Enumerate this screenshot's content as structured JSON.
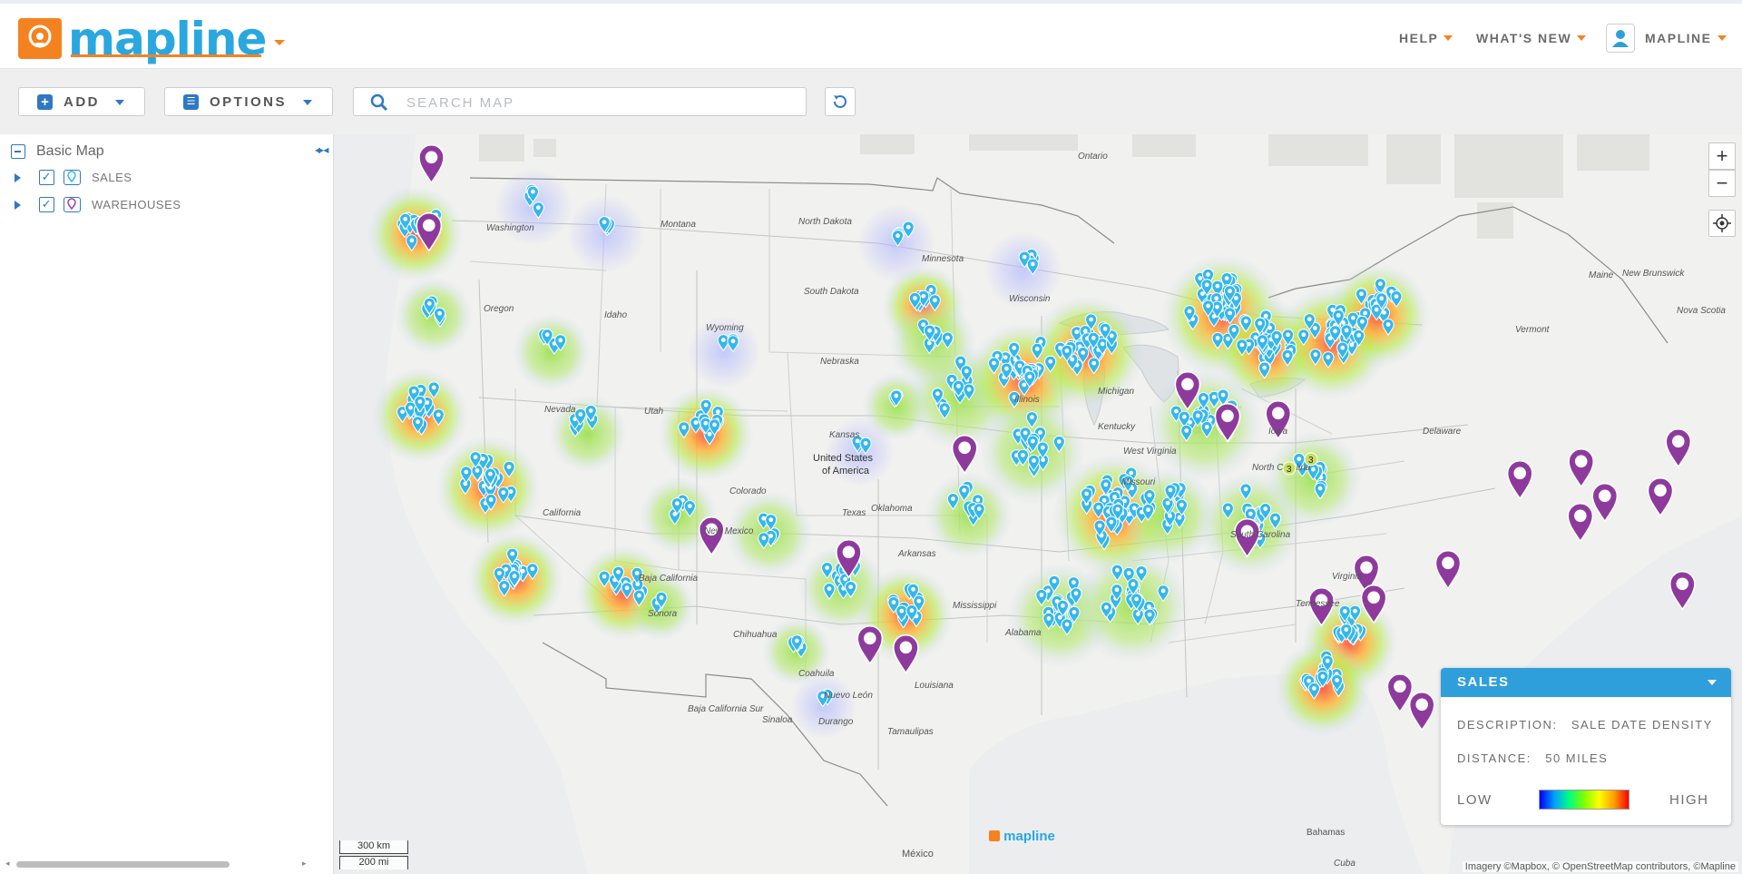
{
  "header": {
    "logo_text": "mapline",
    "nav": {
      "help": "HELP",
      "whats_new": "WHAT'S NEW",
      "account": "MAPLINE"
    }
  },
  "toolbar": {
    "add_label": "ADD",
    "options_label": "OPTIONS",
    "search_placeholder": "SEARCH MAP"
  },
  "sidebar": {
    "root_label": "Basic Map",
    "layers": [
      {
        "label": "SALES",
        "checked": true
      },
      {
        "label": "WAREHOUSES",
        "checked": true
      }
    ]
  },
  "map": {
    "labels": {
      "ontario": "Ontario",
      "montana": "Montana",
      "north_dakota": "North Dakota",
      "washington": "Washington",
      "minnesota": "Minnesota",
      "south_dakota": "South Dakota",
      "idaho": "Idaho",
      "oregon": "Oregon",
      "wyoming": "Wyoming",
      "wisconsin": "Wisconsin",
      "michigan": "Michigan",
      "nebraska": "Nebraska",
      "iowa": "Iowa",
      "united_states_1": "United States",
      "united_states_2": "of America",
      "nevada": "Nevada",
      "utah": "Utah",
      "colorado": "Colorado",
      "illinois": "Illinois",
      "kansas": "Kansas",
      "missouri": "Missouri",
      "kentucky": "Kentucky",
      "west_virginia": "West Virginia",
      "california": "California",
      "new_mexico": "New Mexico",
      "oklahoma": "Oklahoma",
      "arkansas": "Arkansas",
      "tennessee": "Tennessee",
      "north_carolina": "North Carolina",
      "south_carolina": "South Carolina",
      "virginia": "Virginia",
      "mississippi": "Mississippi",
      "alabama": "Alabama",
      "louisiana": "Louisiana",
      "texas": "Texas",
      "baja": "Baja California",
      "sonora": "Sonora",
      "chihuahua": "Chihuahua",
      "coahuila": "Coahuila",
      "nuevo_leon": "Nuevo León",
      "baja_sur": "Baja California Sur",
      "sinaloa": "Sinaloa",
      "durango": "Durango",
      "tamaulipas": "Tamaulipas",
      "mexico": "México",
      "cuba": "Cuba",
      "bahamas": "Bahamas",
      "vermont": "Vermont",
      "maine": "Maine",
      "new_brunswick": "New Brunswick",
      "nova_scotia": "Nova Scotia",
      "delaware": "Delaware",
      "cluster_a": "3",
      "cluster_b": "3"
    },
    "scale_km": "300 km",
    "scale_mi": "200 mi",
    "attribution": "Imagery ©Mapbox, © OpenStreetMap contributors, ©Mapline",
    "watermark": "mapline"
  },
  "legend": {
    "title": "SALES",
    "description_label": "DESCRIPTION:",
    "description_value": "SALE DATE DENSITY",
    "distance_label": "DISTANCE:",
    "distance_value": "50 MILES",
    "low": "LOW",
    "high": "HIGH"
  },
  "colors": {
    "brand_orange": "#f58220",
    "brand_blue": "#2aa7df",
    "ui_blue": "#2f78c4",
    "marker_cyan": "#35b7ec",
    "warehouse_purple": "#8e3a9d"
  }
}
